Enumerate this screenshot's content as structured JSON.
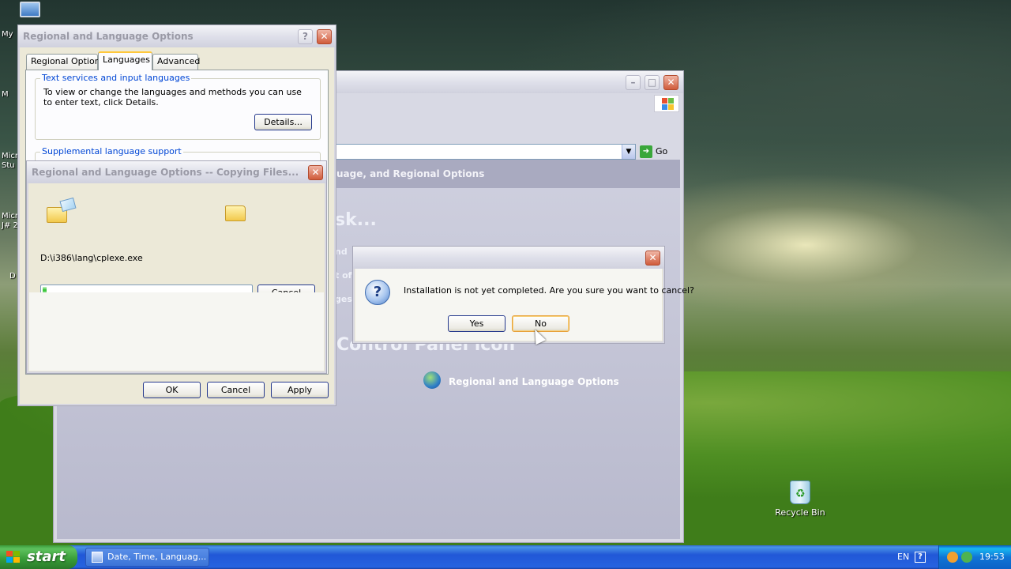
{
  "desktop": {
    "icons": [
      {
        "label": "Recycle Bin"
      }
    ],
    "partial_labels": [
      "My",
      "M",
      "Micro",
      "Stu",
      "Micro",
      "J# 2",
      "D"
    ]
  },
  "control_panel": {
    "header": "uage, and Regional Options",
    "task_heading": "sk...",
    "icon_heading": "Control Panel icon",
    "link_label": "Regional and Language Options",
    "side_fragments": [
      "nd",
      "t of",
      "ges"
    ],
    "go_label": "Go"
  },
  "regional_dialog": {
    "title": "Regional and Language Options",
    "tabs": [
      {
        "label": "Regional Options",
        "active": false
      },
      {
        "label": "Languages",
        "active": true
      },
      {
        "label": "Advanced",
        "active": false
      }
    ],
    "text_services": {
      "label": "Text services and input languages",
      "description": "To view or change the languages and methods you can use to enter text, click Details.",
      "details_button": "Details..."
    },
    "supplemental_label": "Supplemental language support",
    "buttons": {
      "ok": "OK",
      "cancel": "Cancel",
      "apply": "Apply"
    }
  },
  "copy_dialog": {
    "title": "Regional and Language Options -- Copying Files...",
    "file_path": "D:\\i386\\lang\\cplexe.exe",
    "progress": 0.02,
    "cancel_button": "Cancel"
  },
  "confirm_dialog": {
    "message": "Installation is not yet completed. Are you sure you want to cancel?",
    "yes_button": "Yes",
    "no_button": "No"
  },
  "taskbar": {
    "start_label": "start",
    "task_item": "Date, Time, Languag...",
    "language": "EN",
    "clock": "19:53"
  },
  "colors": {
    "taskbar_blue": "#2663e0",
    "start_green": "#379b37",
    "link_blue": "#0046d5"
  }
}
